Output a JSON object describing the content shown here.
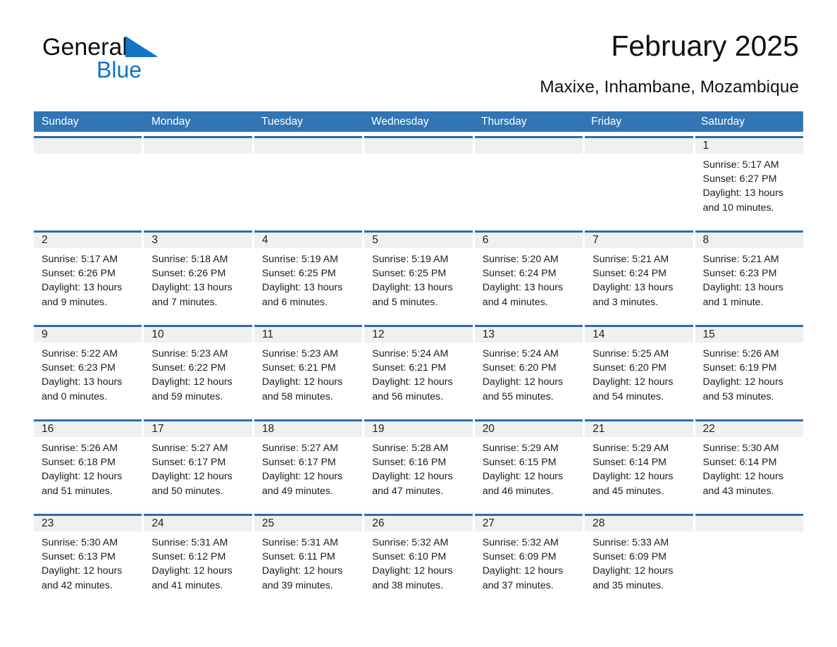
{
  "brand": {
    "name_part1": "General",
    "name_part2": "Blue",
    "triangle_color": "#1273c4"
  },
  "header": {
    "title": "February 2025",
    "subtitle": "Maxixe, Inhambane, Mozambique"
  },
  "theme": {
    "header_blue": "#3175b4",
    "cell_border_blue": "#2e6da8",
    "daynum_band": "#f0f0f0",
    "text": "#1b1b1b"
  },
  "weekdays": [
    "Sunday",
    "Monday",
    "Tuesday",
    "Wednesday",
    "Thursday",
    "Friday",
    "Saturday"
  ],
  "weeks": [
    [
      {
        "day": "",
        "empty": true
      },
      {
        "day": "",
        "empty": true
      },
      {
        "day": "",
        "empty": true
      },
      {
        "day": "",
        "empty": true
      },
      {
        "day": "",
        "empty": true
      },
      {
        "day": "",
        "empty": true
      },
      {
        "day": "1",
        "sunrise": "Sunrise: 5:17 AM",
        "sunset": "Sunset: 6:27 PM",
        "daylight_1": "Daylight: 13 hours",
        "daylight_2": "and 10 minutes."
      }
    ],
    [
      {
        "day": "2",
        "sunrise": "Sunrise: 5:17 AM",
        "sunset": "Sunset: 6:26 PM",
        "daylight_1": "Daylight: 13 hours",
        "daylight_2": "and 9 minutes."
      },
      {
        "day": "3",
        "sunrise": "Sunrise: 5:18 AM",
        "sunset": "Sunset: 6:26 PM",
        "daylight_1": "Daylight: 13 hours",
        "daylight_2": "and 7 minutes."
      },
      {
        "day": "4",
        "sunrise": "Sunrise: 5:19 AM",
        "sunset": "Sunset: 6:25 PM",
        "daylight_1": "Daylight: 13 hours",
        "daylight_2": "and 6 minutes."
      },
      {
        "day": "5",
        "sunrise": "Sunrise: 5:19 AM",
        "sunset": "Sunset: 6:25 PM",
        "daylight_1": "Daylight: 13 hours",
        "daylight_2": "and 5 minutes."
      },
      {
        "day": "6",
        "sunrise": "Sunrise: 5:20 AM",
        "sunset": "Sunset: 6:24 PM",
        "daylight_1": "Daylight: 13 hours",
        "daylight_2": "and 4 minutes."
      },
      {
        "day": "7",
        "sunrise": "Sunrise: 5:21 AM",
        "sunset": "Sunset: 6:24 PM",
        "daylight_1": "Daylight: 13 hours",
        "daylight_2": "and 3 minutes."
      },
      {
        "day": "8",
        "sunrise": "Sunrise: 5:21 AM",
        "sunset": "Sunset: 6:23 PM",
        "daylight_1": "Daylight: 13 hours",
        "daylight_2": "and 1 minute."
      }
    ],
    [
      {
        "day": "9",
        "sunrise": "Sunrise: 5:22 AM",
        "sunset": "Sunset: 6:23 PM",
        "daylight_1": "Daylight: 13 hours",
        "daylight_2": "and 0 minutes."
      },
      {
        "day": "10",
        "sunrise": "Sunrise: 5:23 AM",
        "sunset": "Sunset: 6:22 PM",
        "daylight_1": "Daylight: 12 hours",
        "daylight_2": "and 59 minutes."
      },
      {
        "day": "11",
        "sunrise": "Sunrise: 5:23 AM",
        "sunset": "Sunset: 6:21 PM",
        "daylight_1": "Daylight: 12 hours",
        "daylight_2": "and 58 minutes."
      },
      {
        "day": "12",
        "sunrise": "Sunrise: 5:24 AM",
        "sunset": "Sunset: 6:21 PM",
        "daylight_1": "Daylight: 12 hours",
        "daylight_2": "and 56 minutes."
      },
      {
        "day": "13",
        "sunrise": "Sunrise: 5:24 AM",
        "sunset": "Sunset: 6:20 PM",
        "daylight_1": "Daylight: 12 hours",
        "daylight_2": "and 55 minutes."
      },
      {
        "day": "14",
        "sunrise": "Sunrise: 5:25 AM",
        "sunset": "Sunset: 6:20 PM",
        "daylight_1": "Daylight: 12 hours",
        "daylight_2": "and 54 minutes."
      },
      {
        "day": "15",
        "sunrise": "Sunrise: 5:26 AM",
        "sunset": "Sunset: 6:19 PM",
        "daylight_1": "Daylight: 12 hours",
        "daylight_2": "and 53 minutes."
      }
    ],
    [
      {
        "day": "16",
        "sunrise": "Sunrise: 5:26 AM",
        "sunset": "Sunset: 6:18 PM",
        "daylight_1": "Daylight: 12 hours",
        "daylight_2": "and 51 minutes."
      },
      {
        "day": "17",
        "sunrise": "Sunrise: 5:27 AM",
        "sunset": "Sunset: 6:17 PM",
        "daylight_1": "Daylight: 12 hours",
        "daylight_2": "and 50 minutes."
      },
      {
        "day": "18",
        "sunrise": "Sunrise: 5:27 AM",
        "sunset": "Sunset: 6:17 PM",
        "daylight_1": "Daylight: 12 hours",
        "daylight_2": "and 49 minutes."
      },
      {
        "day": "19",
        "sunrise": "Sunrise: 5:28 AM",
        "sunset": "Sunset: 6:16 PM",
        "daylight_1": "Daylight: 12 hours",
        "daylight_2": "and 47 minutes."
      },
      {
        "day": "20",
        "sunrise": "Sunrise: 5:29 AM",
        "sunset": "Sunset: 6:15 PM",
        "daylight_1": "Daylight: 12 hours",
        "daylight_2": "and 46 minutes."
      },
      {
        "day": "21",
        "sunrise": "Sunrise: 5:29 AM",
        "sunset": "Sunset: 6:14 PM",
        "daylight_1": "Daylight: 12 hours",
        "daylight_2": "and 45 minutes."
      },
      {
        "day": "22",
        "sunrise": "Sunrise: 5:30 AM",
        "sunset": "Sunset: 6:14 PM",
        "daylight_1": "Daylight: 12 hours",
        "daylight_2": "and 43 minutes."
      }
    ],
    [
      {
        "day": "23",
        "sunrise": "Sunrise: 5:30 AM",
        "sunset": "Sunset: 6:13 PM",
        "daylight_1": "Daylight: 12 hours",
        "daylight_2": "and 42 minutes."
      },
      {
        "day": "24",
        "sunrise": "Sunrise: 5:31 AM",
        "sunset": "Sunset: 6:12 PM",
        "daylight_1": "Daylight: 12 hours",
        "daylight_2": "and 41 minutes."
      },
      {
        "day": "25",
        "sunrise": "Sunrise: 5:31 AM",
        "sunset": "Sunset: 6:11 PM",
        "daylight_1": "Daylight: 12 hours",
        "daylight_2": "and 39 minutes."
      },
      {
        "day": "26",
        "sunrise": "Sunrise: 5:32 AM",
        "sunset": "Sunset: 6:10 PM",
        "daylight_1": "Daylight: 12 hours",
        "daylight_2": "and 38 minutes."
      },
      {
        "day": "27",
        "sunrise": "Sunrise: 5:32 AM",
        "sunset": "Sunset: 6:09 PM",
        "daylight_1": "Daylight: 12 hours",
        "daylight_2": "and 37 minutes."
      },
      {
        "day": "28",
        "sunrise": "Sunrise: 5:33 AM",
        "sunset": "Sunset: 6:09 PM",
        "daylight_1": "Daylight: 12 hours",
        "daylight_2": "and 35 minutes."
      },
      {
        "day": "",
        "empty": true
      }
    ]
  ]
}
